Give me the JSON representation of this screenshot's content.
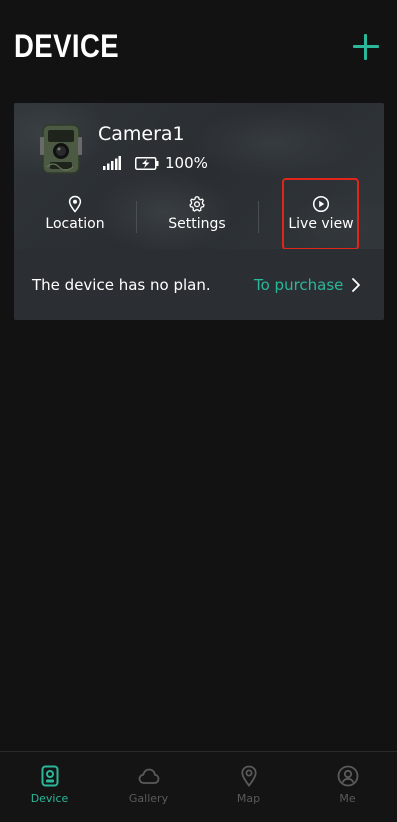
{
  "header": {
    "title": "DEVICE",
    "add_icon": "plus-icon"
  },
  "device": {
    "name": "Camera1",
    "signal_icon": "signal-bars-icon",
    "battery_icon": "battery-charging-icon",
    "battery_level": "100%",
    "actions": [
      {
        "label": "Location",
        "icon": "location-pin-icon"
      },
      {
        "label": "Settings",
        "icon": "gear-icon"
      },
      {
        "label": "Live view",
        "icon": "play-circle-icon"
      }
    ],
    "plan_text": "The device has no plan.",
    "purchase_label": "To purchase"
  },
  "nav": {
    "items": [
      {
        "label": "Device",
        "icon": "device-icon",
        "active": true
      },
      {
        "label": "Gallery",
        "icon": "cloud-icon",
        "active": false
      },
      {
        "label": "Map",
        "icon": "map-pin-icon",
        "active": false
      },
      {
        "label": "Me",
        "icon": "user-icon",
        "active": false
      }
    ]
  },
  "colors": {
    "accent": "#2bb79a",
    "highlight": "#e0251b",
    "background": "#121212",
    "card": "#2b2f33"
  }
}
